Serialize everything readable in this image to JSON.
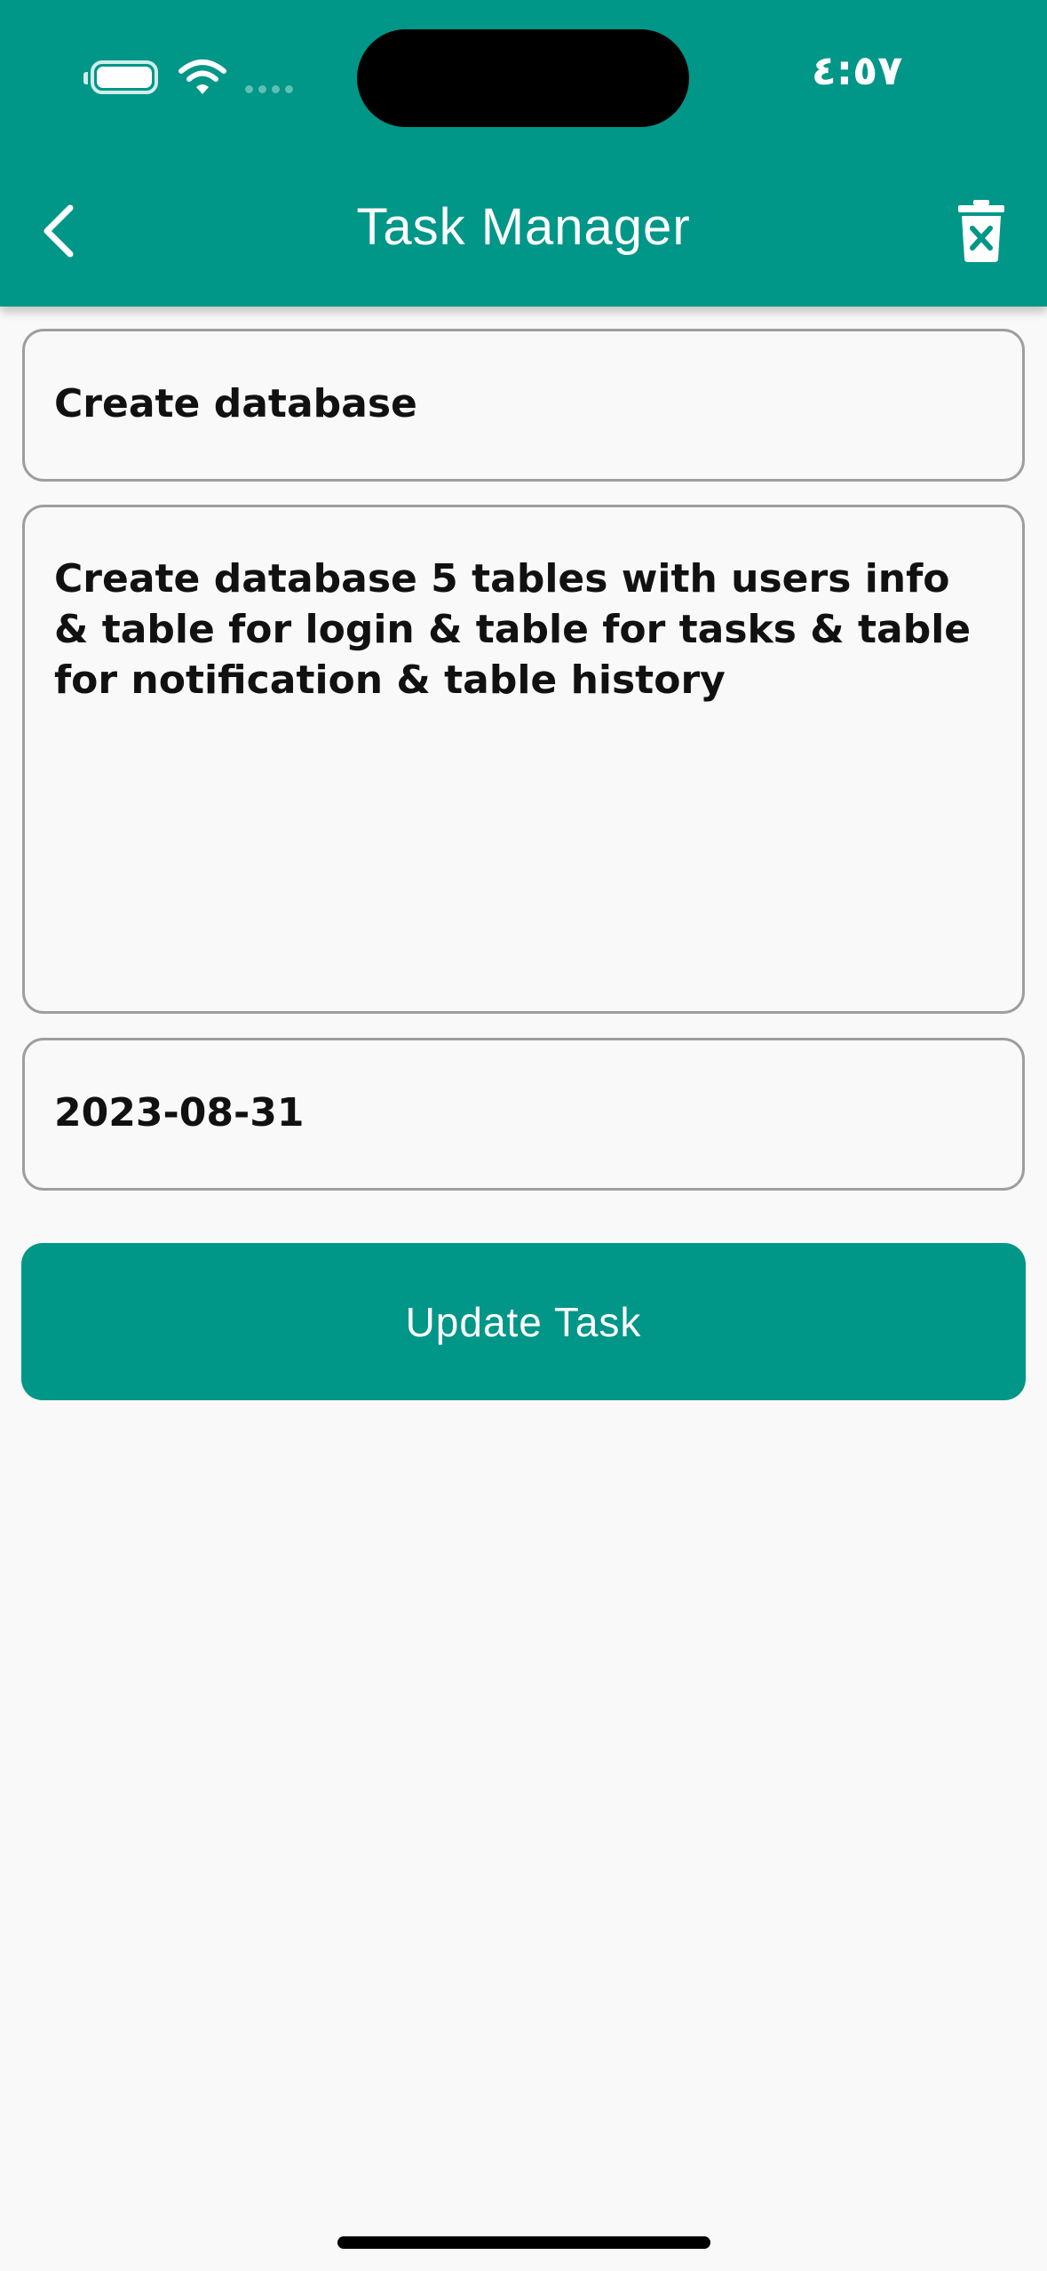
{
  "status_bar": {
    "time": "٤:٥٧",
    "battery_icon": "battery-icon",
    "wifi_icon": "wifi-icon",
    "signal_icon": "cellular-signal-icon"
  },
  "app_bar": {
    "title": "Task Manager",
    "background_color": "#009688",
    "back_icon": "chevron-left-icon",
    "delete_icon": "trash-x-icon"
  },
  "form": {
    "title_value": "Create database",
    "description_value": "Create database 5 tables with users info & table for login & table for tasks & table for notification & table history",
    "date_value": "2023-08-31"
  },
  "update_button": {
    "label": "Update Task",
    "color": "#009688"
  }
}
